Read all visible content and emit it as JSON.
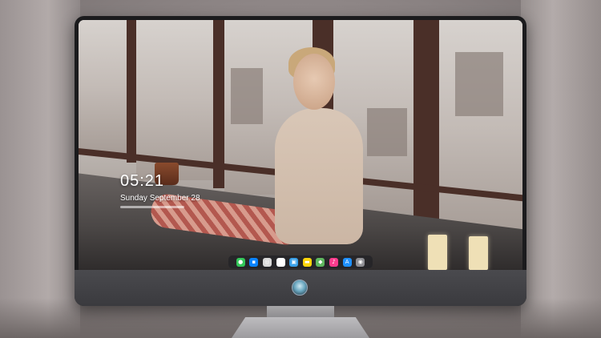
{
  "lock_screen": {
    "time": "05:21",
    "date": "Sunday September 28"
  },
  "dock": {
    "items": [
      {
        "name": "messages-icon",
        "glyph": "●",
        "color": "#34c759"
      },
      {
        "name": "chat-icon",
        "glyph": "▪",
        "color": "#0a84ff"
      },
      {
        "name": "safari-icon",
        "glyph": "◎",
        "color": "#d9d9d9"
      },
      {
        "name": "photos-icon",
        "glyph": "✿",
        "color": "#ffffff"
      },
      {
        "name": "finder-icon",
        "glyph": "▣",
        "color": "#3aa0e8"
      },
      {
        "name": "notes-icon",
        "glyph": "▬",
        "color": "#ffd60a"
      },
      {
        "name": "maps-icon",
        "glyph": "◆",
        "color": "#5fb85f"
      },
      {
        "name": "music-icon",
        "glyph": "♪",
        "color": "#fc3c8d"
      },
      {
        "name": "app-store-icon",
        "glyph": "A",
        "color": "#1e90ff"
      },
      {
        "name": "camera-icon",
        "glyph": "◉",
        "color": "#8e8e93"
      }
    ]
  },
  "colors": {
    "monitor_bezel": "#1b1b1d",
    "chin": "#3a3a3e",
    "dock_background": "#232326"
  }
}
